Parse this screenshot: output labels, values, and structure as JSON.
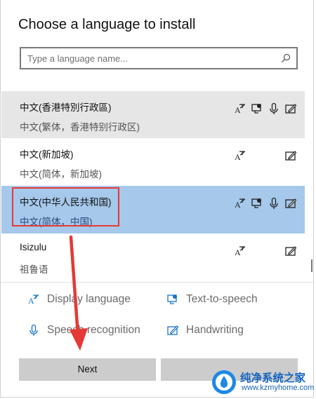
{
  "dialog": {
    "title": "Choose a language to install",
    "search": {
      "placeholder": "Type a language name...",
      "value": ""
    }
  },
  "languages": [
    {
      "name": "中文(香港特別行政區)",
      "native": "中文(繁体，香港特别行政区)",
      "capabilities": [
        "display-language",
        "text-to-speech",
        "speech-recognition",
        "handwriting"
      ],
      "state": "hover"
    },
    {
      "name": "中文(新加坡)",
      "native": "中文(简体，新加坡)",
      "capabilities": [
        "display-language",
        "handwriting"
      ],
      "state": "normal"
    },
    {
      "name": "中文(中华人民共和国)",
      "native": "中文(简体，中国)",
      "capabilities": [
        "display-language",
        "text-to-speech",
        "speech-recognition",
        "handwriting"
      ],
      "state": "selected"
    },
    {
      "name": "Isizulu",
      "native": "祖鲁语",
      "capabilities": [
        "display-language",
        "handwriting"
      ],
      "state": "normal"
    }
  ],
  "legend": {
    "display_language": "Display language",
    "text_to_speech": "Text-to-speech",
    "speech_recognition": "Speech recognition",
    "handwriting": "Handwriting"
  },
  "buttons": {
    "next": "Next",
    "cancel": ""
  },
  "watermark": {
    "name": "纯净系统之家",
    "url": "www.kzmyhome.com"
  },
  "colors": {
    "selected": "#a5c8eb",
    "hover": "#e6e6e6",
    "annotation": "#e53935",
    "button": "#cccccc"
  }
}
